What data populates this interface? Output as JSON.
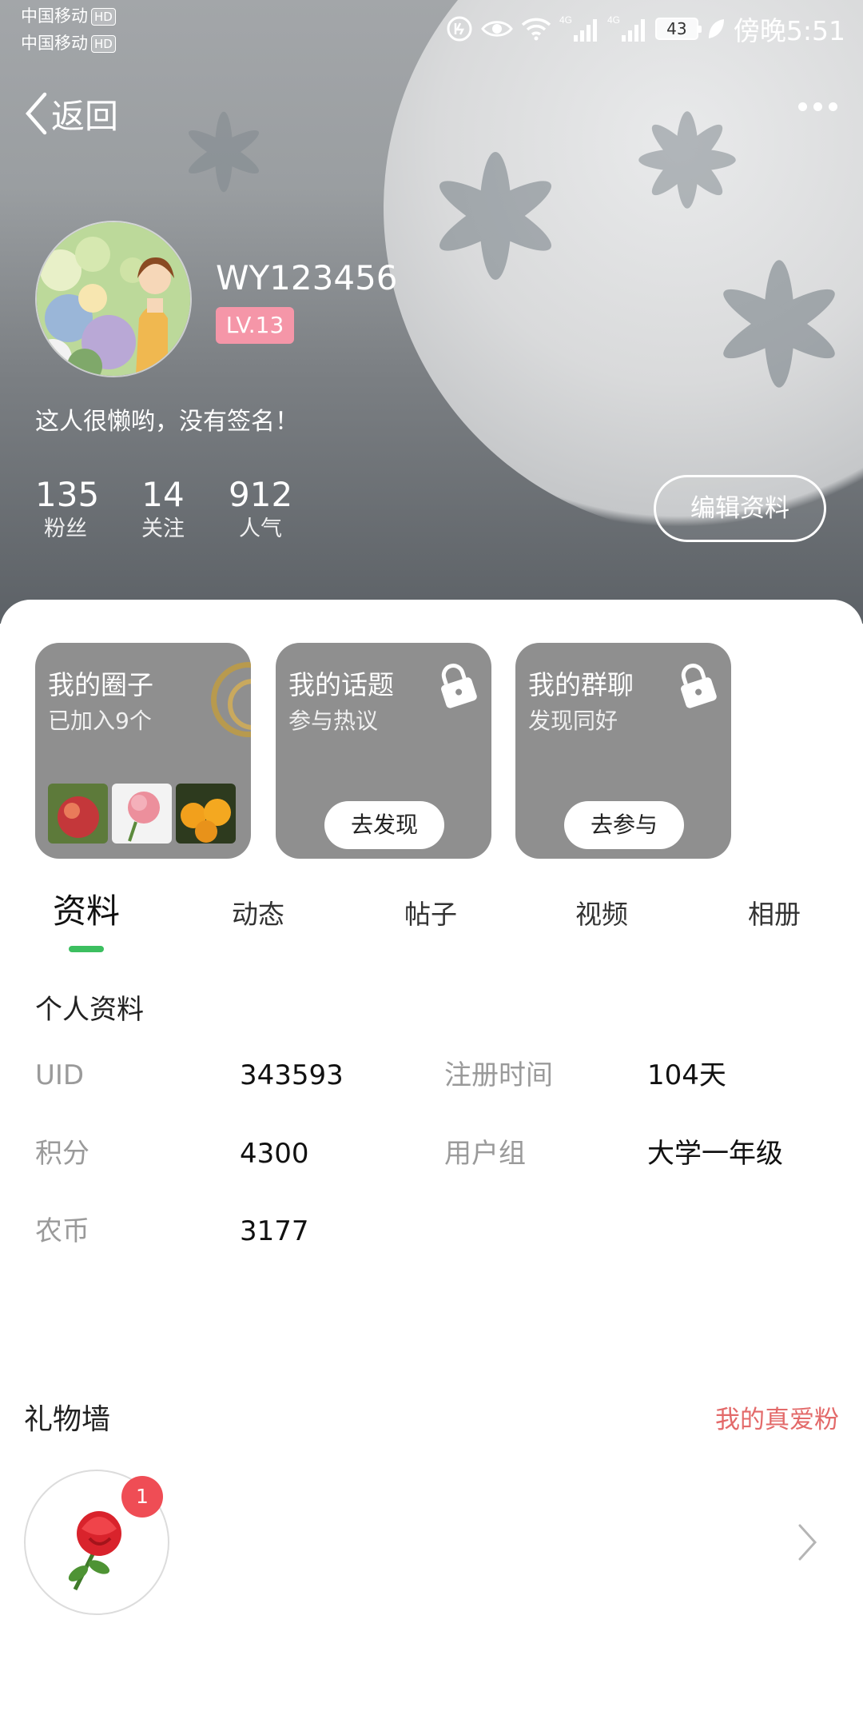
{
  "status_bar": {
    "carrier1": "中国移动",
    "carrier2": "中国移动",
    "hd": "HD",
    "network1": "4G",
    "network2": "4G",
    "battery": "43",
    "time": "傍晚5:51"
  },
  "nav": {
    "back_label": "返回"
  },
  "profile": {
    "username": "WY123456",
    "level": "LV.13",
    "signature": "这人很懒哟，没有签名！",
    "stats": [
      {
        "value": "135",
        "label": "粉丝"
      },
      {
        "value": "14",
        "label": "关注"
      },
      {
        "value": "912",
        "label": "人气"
      }
    ],
    "edit_label": "编辑资料"
  },
  "cards": [
    {
      "title": "我的圈子",
      "subtitle": "已加入9个"
    },
    {
      "title": "我的话题",
      "subtitle": "参与热议",
      "button": "去发现"
    },
    {
      "title": "我的群聊",
      "subtitle": "发现同好",
      "button": "去参与"
    }
  ],
  "tabs": [
    "资料",
    "动态",
    "帖子",
    "视频",
    "相册"
  ],
  "info": {
    "title": "个人资料",
    "uid_label": "UID",
    "uid": "343593",
    "reg_label": "注册时间",
    "reg": "104天",
    "points_label": "积分",
    "points": "4300",
    "group_label": "用户组",
    "group": "大学一年级",
    "coin_label": "农币",
    "coin": "3177"
  },
  "gifts": {
    "title": "礼物墙",
    "link": "我的真爱粉",
    "count": "1"
  },
  "colors": {
    "accent": "#3cbf60",
    "level_bg": "#f596a8",
    "link": "#e36a6a",
    "badge": "#ef4d55"
  }
}
